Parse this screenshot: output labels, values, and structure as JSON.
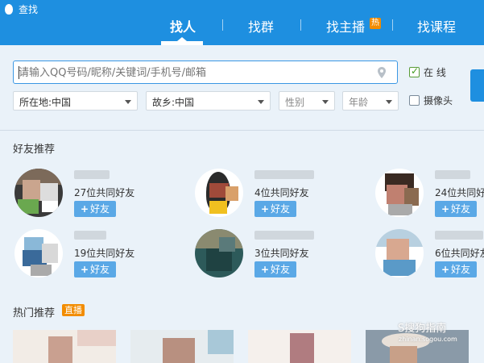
{
  "header": {
    "title": "查找",
    "tabs": [
      {
        "label": "找人",
        "active": true
      },
      {
        "label": "找群",
        "active": false
      },
      {
        "label": "找主播",
        "active": false,
        "badge": "热"
      },
      {
        "label": "找课程",
        "active": false
      }
    ]
  },
  "search": {
    "placeholder": "请输入QQ号码/昵称/关键词/手机号/邮箱",
    "value": "",
    "online_label": "在 线",
    "online_checked": true,
    "camera_label": "摄像头",
    "camera_checked": false
  },
  "filters": {
    "location": "所在地:中国",
    "hometown": "故乡:中国",
    "gender": "性别",
    "age": "年龄"
  },
  "friends": {
    "section_title": "好友推荐",
    "add_label": "好友",
    "items": [
      {
        "mutual": "27位共同好友"
      },
      {
        "mutual": "4位共同好友"
      },
      {
        "mutual": "24位共同好友"
      },
      {
        "mutual": "19位共同好友"
      },
      {
        "mutual": "3位共同好友"
      },
      {
        "mutual": "6位共同好友"
      }
    ]
  },
  "hot": {
    "section_title": "热门推荐",
    "badge": "直播"
  },
  "watermark": {
    "line1": "S搜狗指南",
    "line2": "zhinan.sogou.com"
  },
  "colors": {
    "header": "#1e8fe0",
    "accent_orange": "#f28c00",
    "add_button": "#5aa8e6",
    "background": "#eaf2f9"
  }
}
